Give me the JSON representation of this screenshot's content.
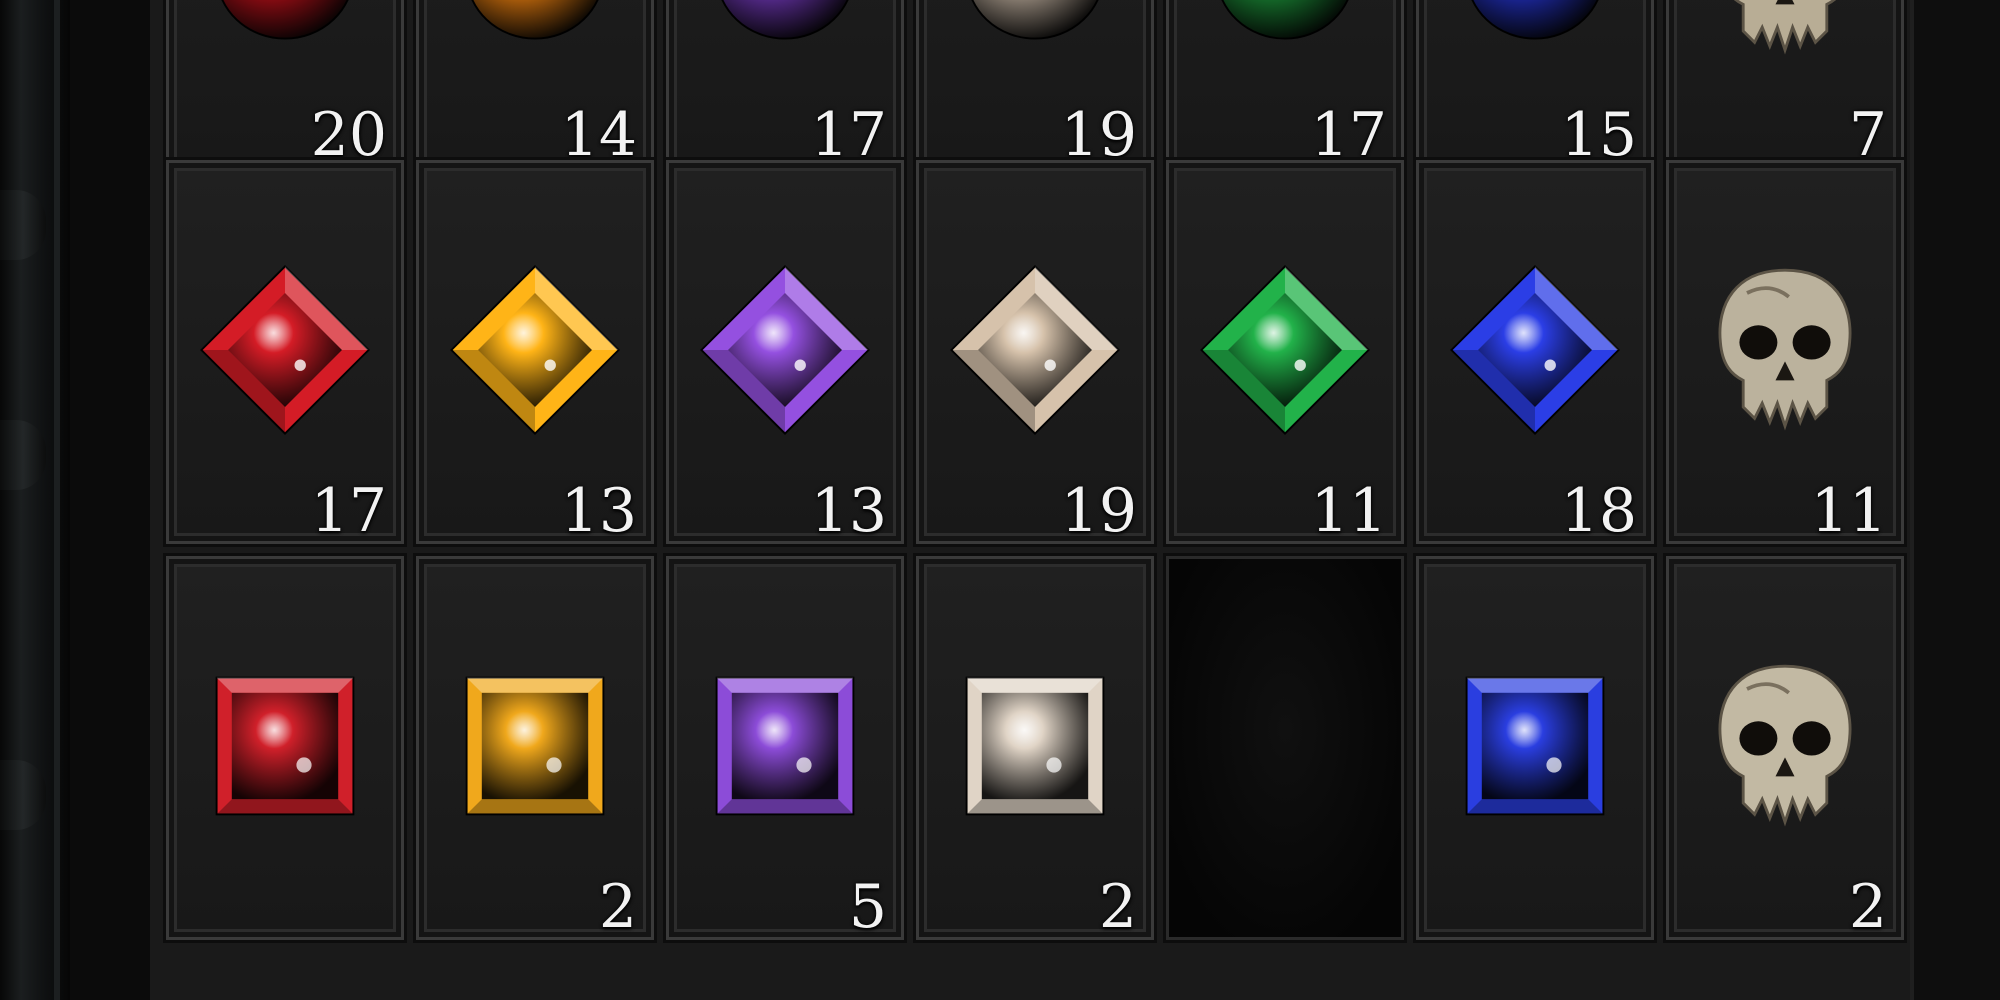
{
  "inventory": {
    "rows": [
      {
        "item_type": "chipped",
        "cells": [
          {
            "icon": "red-gem-icon",
            "color": "#c8101a",
            "count": "20"
          },
          {
            "icon": "orange-gem-icon",
            "color": "#ff8a10",
            "count": "14"
          },
          {
            "icon": "purple-gem-icon",
            "color": "#7a3cc8",
            "count": "17"
          },
          {
            "icon": "white-gem-icon",
            "color": "#c9b8a6",
            "count": "19"
          },
          {
            "icon": "green-gem-icon",
            "color": "#1d9a3c",
            "count": "17"
          },
          {
            "icon": "blue-gem-icon",
            "color": "#2535d8",
            "count": "15"
          },
          {
            "icon": "skull-icon",
            "color": "#b8ad95",
            "count": "7"
          }
        ]
      },
      {
        "item_type": "diamond-cut",
        "cells": [
          {
            "icon": "red-gem-icon",
            "color": "#d41c26",
            "count": "17"
          },
          {
            "icon": "orange-gem-icon",
            "color": "#ffb417",
            "count": "13"
          },
          {
            "icon": "purple-gem-icon",
            "color": "#9450e0",
            "count": "13"
          },
          {
            "icon": "white-gem-icon",
            "color": "#d6c2ab",
            "count": "19"
          },
          {
            "icon": "green-gem-icon",
            "color": "#22b24a",
            "count": "11"
          },
          {
            "icon": "blue-gem-icon",
            "color": "#2b3ee6",
            "count": "18"
          },
          {
            "icon": "skull-icon",
            "color": "#bbb29d",
            "count": "11"
          }
        ]
      },
      {
        "item_type": "square-cut",
        "cells": [
          {
            "icon": "red-gem-icon",
            "color": "#d0202a",
            "count": ""
          },
          {
            "icon": "orange-gem-icon",
            "color": "#f0a81c",
            "count": "2"
          },
          {
            "icon": "purple-gem-icon",
            "color": "#8c4cd8",
            "count": "5"
          },
          {
            "icon": "white-gem-icon",
            "color": "#e0d4c6",
            "count": "2"
          },
          {
            "icon": "",
            "color": "",
            "count": ""
          },
          {
            "icon": "blue-gem-icon",
            "color": "#2a3ee0",
            "count": ""
          },
          {
            "icon": "skull-icon",
            "color": "#c2b9a3",
            "count": "2"
          }
        ]
      }
    ]
  }
}
